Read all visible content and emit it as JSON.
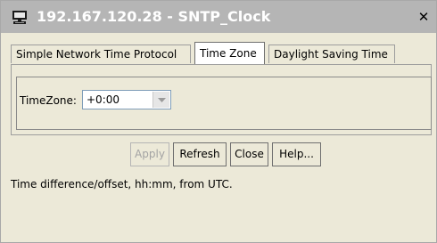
{
  "window": {
    "title": "192.167.120.28 - SNTP_Clock",
    "title_icon": "desktop-computer-icon",
    "close_glyph": "✕"
  },
  "tabs": [
    {
      "label": "Simple Network Time Protocol",
      "active": false
    },
    {
      "label": "Time Zone",
      "active": true
    },
    {
      "label": "Daylight Saving Time",
      "active": false
    }
  ],
  "form": {
    "timezone_label": "TimeZone:",
    "timezone_value": "+0:00"
  },
  "buttons": {
    "apply": "Apply",
    "refresh": "Refresh",
    "close": "Close",
    "help": "Help..."
  },
  "status_text": "Time difference/offset, hh:mm, from UTC.",
  "colors": {
    "titlebar": "#b5b5b5",
    "title_text": "#ffffff",
    "window_bg": "#ece9d8",
    "disabled_text": "#a3a3a3"
  }
}
